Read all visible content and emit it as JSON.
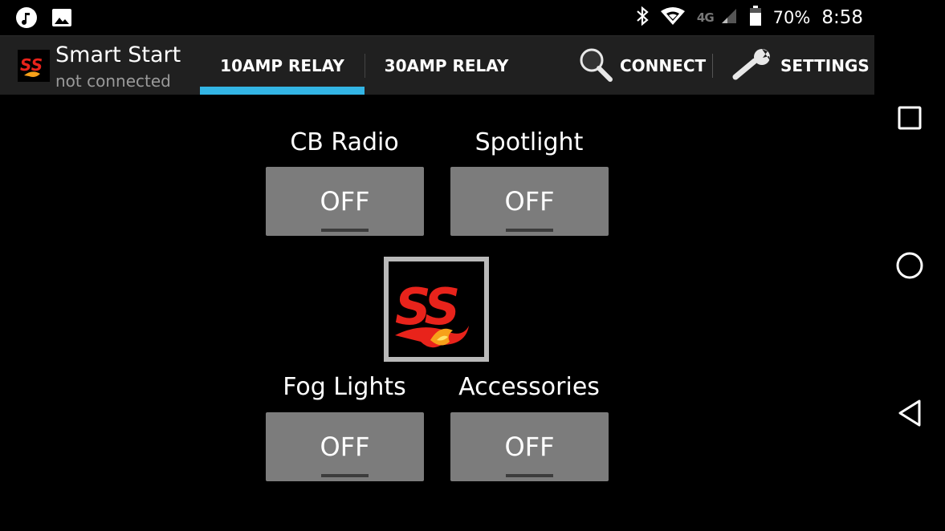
{
  "status_bar": {
    "left_icons": [
      "music-note-icon",
      "image-icon"
    ],
    "right_icons": [
      "bluetooth-icon",
      "wifi-icon",
      "cell-signal-icon",
      "battery-icon"
    ],
    "network": "4G",
    "battery": "70%",
    "time": "8:58"
  },
  "app": {
    "title": "Smart Start",
    "subtitle": "not connected"
  },
  "tabs": [
    {
      "label": "10AMP RELAY",
      "selected": true
    },
    {
      "label": "30AMP RELAY",
      "selected": false
    }
  ],
  "actions": {
    "connect": {
      "label": "CONNECT",
      "icon": "search-icon"
    },
    "settings": {
      "label": "SETTINGS",
      "icon": "wrench-icon"
    }
  },
  "relays": [
    {
      "label": "CB Radio",
      "state": "OFF"
    },
    {
      "label": "Spotlight",
      "state": "OFF"
    },
    {
      "label": "Fog Lights",
      "state": "OFF"
    },
    {
      "label": "Accessories",
      "state": "OFF"
    }
  ],
  "colors": {
    "accent": "#33b5e5",
    "action_bar": "#202020",
    "button": "#7c7c7c",
    "logo_red": "#e8231b",
    "logo_flame": "#f7a11a"
  },
  "nav_icons": [
    "recents-square-icon",
    "home-circle-icon",
    "back-triangle-icon"
  ]
}
